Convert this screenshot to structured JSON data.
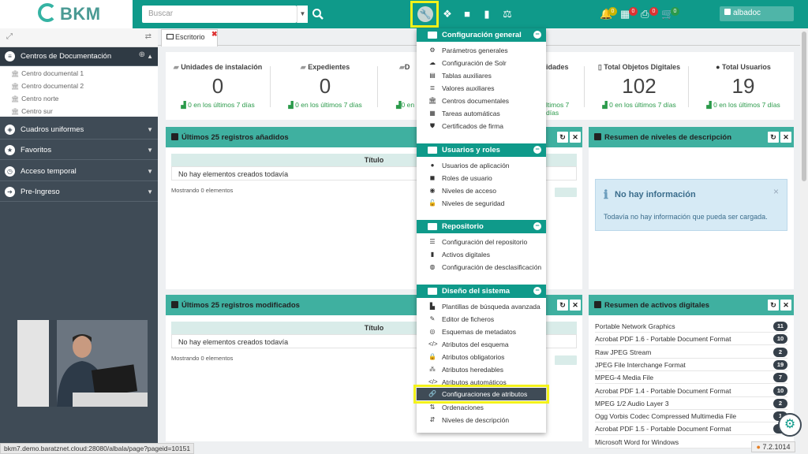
{
  "header": {
    "logo_text": "BKM",
    "search_placeholder": "Buscar",
    "user": "albadoc",
    "badges": {
      "notifications": "0",
      "calendar": "0",
      "print": "0",
      "cart": "0"
    }
  },
  "sidebar": {
    "sections": [
      {
        "label": "Centros de Documentación",
        "icon": "list-icon"
      },
      {
        "label": "Cuadros uniformes",
        "icon": "layers-icon"
      },
      {
        "label": "Favoritos",
        "icon": "star-icon"
      },
      {
        "label": "Acceso temporal",
        "icon": "clock-icon"
      },
      {
        "label": "Pre-Ingreso",
        "icon": "login-icon"
      }
    ],
    "tree": [
      "Centro documental 1",
      "Centro documental 2",
      "Centro norte",
      "Centro sur"
    ]
  },
  "tabs": {
    "active": "Escritorio",
    "close": "✖"
  },
  "stats": [
    {
      "title": "Unidades de instalación",
      "value": "0",
      "sub": "0 en los últimos 7 días"
    },
    {
      "title": "Expedientes",
      "value": "0",
      "sub": "0 en los últimos 7 días"
    },
    {
      "title": "D",
      "value": "",
      "sub": "0 en"
    },
    {
      "title": "idades",
      "value": "",
      "sub": "ltimos 7 días"
    },
    {
      "title": "Total Objetos Digitales",
      "value": "102",
      "sub": "0 en los últimos 7 días"
    },
    {
      "title": "Total Usuarios",
      "value": "19",
      "sub": "0 en los últimos 7 días"
    }
  ],
  "panels": {
    "added": {
      "title": "Últimos 25 registros añadidos",
      "col": "Título",
      "empty": "No hay elementos creados todavía",
      "count": "Mostrando 0 elementos"
    },
    "modified": {
      "title": "Últimos 25 registros modificados",
      "col": "Título",
      "empty": "No hay elementos creados todavía",
      "count": "Mostrando 0 elementos"
    },
    "levels": {
      "title": "Resumen de niveles de descripción",
      "info_title": "No hay información",
      "info_text": "Todavía no hay información que pueda ser cargada.",
      "close": "×"
    },
    "assets": {
      "title": "Resumen de activos digitales",
      "rows": [
        {
          "name": "Portable Network Graphics",
          "count": "11"
        },
        {
          "name": "Acrobat PDF 1.6 - Portable Document Format",
          "count": "10"
        },
        {
          "name": "Raw JPEG Stream",
          "count": "2"
        },
        {
          "name": "JPEG File Interchange Format",
          "count": "19"
        },
        {
          "name": "MPEG-4 Media File",
          "count": "7"
        },
        {
          "name": "Acrobat PDF 1.4 - Portable Document Format",
          "count": "10"
        },
        {
          "name": "MPEG 1/2 Audio Layer 3",
          "count": "2"
        },
        {
          "name": "Ogg Vorbis Codec Compressed Multimedia File",
          "count": "1"
        },
        {
          "name": "Acrobat PDF 1.5 - Portable Document Format",
          "count": "1"
        },
        {
          "name": "Microsoft Word for Windows",
          "count": ""
        }
      ]
    }
  },
  "menu": {
    "sections": [
      {
        "title": "Configuración general",
        "items": [
          "Parámetros generales",
          "Configuración de Solr",
          "Tablas auxiliares",
          "Valores auxiliares",
          "Centros documentales",
          "Tareas automáticas",
          "Certificados de firma"
        ]
      },
      {
        "title": "Usuarios y roles",
        "items": [
          "Usuarios de aplicación",
          "Roles de usuario",
          "Niveles de acceso",
          "Niveles de seguridad"
        ]
      },
      {
        "title": "Repositorio",
        "items": [
          "Configuración del repositorio",
          "Activos digitales",
          "Configuración de desclasificación"
        ]
      },
      {
        "title": "Diseño del sistema",
        "items": [
          "Plantillas de búsqueda avanzada",
          "Editor de ficheros",
          "Esquemas de metadatos",
          "Atributos del esquema",
          "Atributos obligatorios",
          "Atributos heredables",
          "Atributos automáticos",
          "Configuraciones de atributos",
          "Ordenaciones",
          "Niveles de descripción"
        ]
      }
    ]
  },
  "status_url": "bkm7.demo.baratznet.cloud:28080/albala/page?pageid=10151",
  "version": "7.2.1014"
}
